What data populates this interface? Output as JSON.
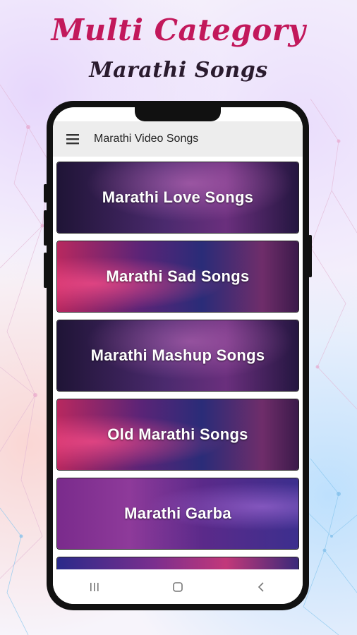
{
  "promo": {
    "headline_1": "Multi Category",
    "headline_2": "Marathi Songs"
  },
  "app": {
    "title": "Marathi Video Songs",
    "menu_icon": "hamburger-menu-icon"
  },
  "categories": [
    {
      "label": "Marathi Love Songs"
    },
    {
      "label": "Marathi Sad Songs"
    },
    {
      "label": "Marathi Mashup Songs"
    },
    {
      "label": "Old Marathi Songs"
    },
    {
      "label": "Marathi Garba"
    }
  ],
  "nav_icons": [
    "recent-apps-icon",
    "home-icon",
    "back-icon"
  ],
  "colors": {
    "headline_1": "#c2185b",
    "headline_2": "#2a1b2e",
    "app_bar": "#ededed"
  }
}
